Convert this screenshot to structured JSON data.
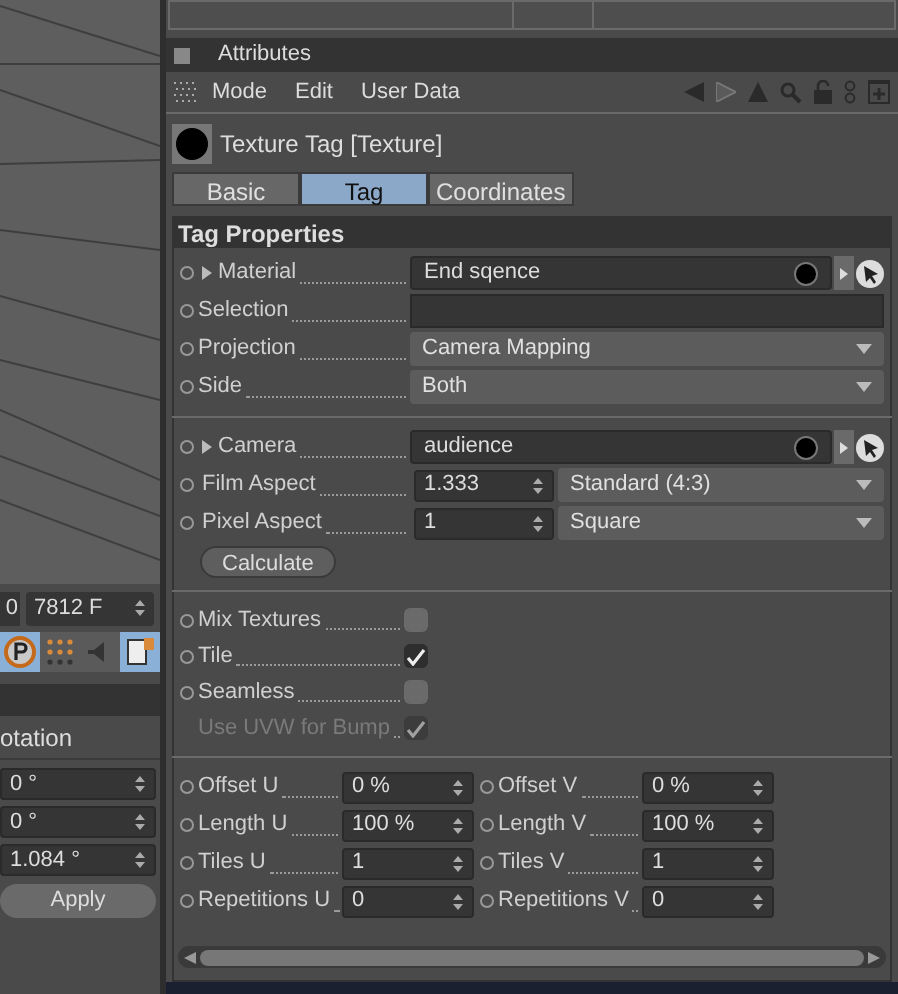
{
  "timeline": {
    "start": "0",
    "end": "7812 F"
  },
  "left_panel": {
    "section_title": "otation",
    "fields": [
      "0 °",
      "0 °",
      "1.084 °"
    ],
    "apply_button": "Apply"
  },
  "attributes": {
    "title": "Attributes",
    "menu": [
      "Mode",
      "Edit",
      "User Data"
    ],
    "object_title": "Texture Tag [Texture]",
    "tabs": [
      {
        "label": "Basic",
        "selected": false
      },
      {
        "label": "Tag",
        "selected": true
      },
      {
        "label": "Coordinates",
        "selected": false
      }
    ],
    "section": "Tag Properties",
    "rows": [
      {
        "kind": "link",
        "label": "Material",
        "value": "End sqence"
      },
      {
        "kind": "text",
        "label": "Selection"
      },
      {
        "kind": "dropdown",
        "label": "Projection",
        "value": "Camera Mapping"
      },
      {
        "kind": "dropdown",
        "label": "Side",
        "value": "Both"
      },
      {
        "kind": "separator"
      },
      {
        "kind": "link",
        "label": "Camera",
        "value": "audience"
      },
      {
        "kind": "number_dropdown",
        "label": "Film Aspect",
        "value": "1.333",
        "option": "Standard (4:3)"
      },
      {
        "kind": "number_dropdown",
        "label": "Pixel Aspect",
        "value": "1",
        "option": "Square"
      },
      {
        "kind": "button",
        "label": "Calculate"
      },
      {
        "kind": "separator"
      },
      {
        "kind": "checkbox",
        "label": "Mix Textures",
        "checked": false,
        "disabled": false
      },
      {
        "kind": "checkbox",
        "label": "Tile",
        "checked": true,
        "disabled": false
      },
      {
        "kind": "checkbox",
        "label": "Seamless",
        "checked": false,
        "disabled": false
      },
      {
        "kind": "checkbox",
        "label": "Use UVW for Bump",
        "checked": true,
        "disabled": true
      },
      {
        "kind": "separator"
      },
      {
        "kind": "pair",
        "label": "Offset U",
        "value": "0 %",
        "label2": "Offset V",
        "value2": "0 %"
      },
      {
        "kind": "pair",
        "label": "Length U",
        "value": "100 %",
        "label2": "Length V",
        "value2": "100 %"
      },
      {
        "kind": "pair",
        "label": "Tiles U",
        "value": "1",
        "label2": "Tiles V",
        "value2": "1"
      },
      {
        "kind": "pair",
        "label": "Repetitions U",
        "value": "0",
        "label2": "Repetitions V",
        "value2": "0"
      }
    ]
  }
}
